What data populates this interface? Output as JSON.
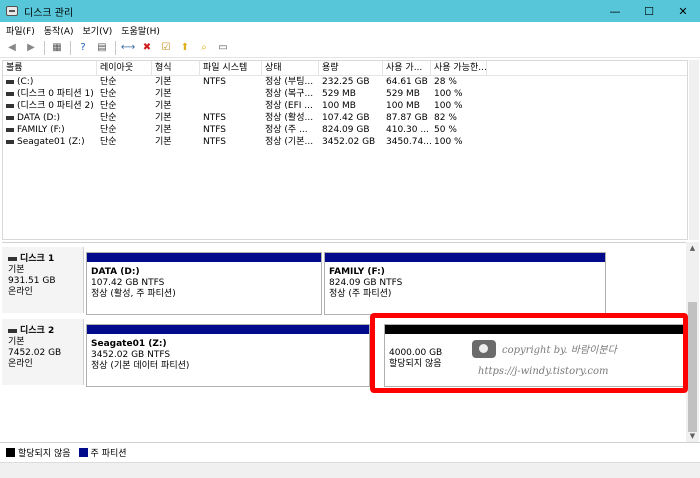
{
  "window": {
    "title": "디스크 관리",
    "controls": [
      "—",
      "☐",
      "✕"
    ]
  },
  "menu": [
    "파일(F)",
    "동작(A)",
    "보기(V)",
    "도움말(H)"
  ],
  "toolbar": [
    {
      "name": "back-icon",
      "glyph": "◀",
      "color": "#888888"
    },
    {
      "name": "forward-icon",
      "glyph": "▶",
      "color": "#888888"
    },
    {
      "name": "properties-icon",
      "glyph": "▦",
      "color": "#555555"
    },
    {
      "name": "help-icon",
      "glyph": "?",
      "color": "#1f5fbf"
    },
    {
      "name": "view-icon",
      "glyph": "▤",
      "color": "#555555"
    },
    {
      "name": "connect-icon",
      "glyph": "⟷",
      "color": "#3a6ea5"
    },
    {
      "name": "delete-icon",
      "glyph": "✖",
      "color": "#d11f1f"
    },
    {
      "name": "checklist-icon",
      "glyph": "☑",
      "color": "#c88a1a"
    },
    {
      "name": "folder-up-icon",
      "glyph": "⬆",
      "color": "#e0b020"
    },
    {
      "name": "folder-search-icon",
      "glyph": "⌕",
      "color": "#e0b020"
    },
    {
      "name": "console-icon",
      "glyph": "▭",
      "color": "#555555"
    }
  ],
  "volume_list": {
    "columns": [
      "볼륨",
      "레이아웃",
      "형식",
      "파일 시스템",
      "상태",
      "용량",
      "사용 가...",
      "사용 가능한..."
    ],
    "rows": [
      [
        "(C:)",
        "단순",
        "기본",
        "NTFS",
        "정상 (부팅...",
        "232.25 GB",
        "64.61 GB",
        "28 %"
      ],
      [
        "(디스크 0 파티션 1)",
        "단순",
        "기본",
        "",
        "정상 (복구...",
        "529 MB",
        "529 MB",
        "100 %"
      ],
      [
        "(디스크 0 파티션 2)",
        "단순",
        "기본",
        "",
        "정상 (EFI ...",
        "100 MB",
        "100 MB",
        "100 %"
      ],
      [
        "DATA (D:)",
        "단순",
        "기본",
        "NTFS",
        "정상 (활성...",
        "107.42 GB",
        "87.87 GB",
        "82 %"
      ],
      [
        "FAMILY (F:)",
        "단순",
        "기본",
        "NTFS",
        "정상 (주 ...",
        "824.09 GB",
        "410.30 ...",
        "50 %"
      ],
      [
        "Seagate01 (Z:)",
        "단순",
        "기본",
        "NTFS",
        "정상 (기본...",
        "3452.02 GB",
        "3450.74...",
        "100 %"
      ]
    ]
  },
  "disks": [
    {
      "name": "디스크 1",
      "type": "기본",
      "size": "931.51 GB",
      "status": "온라인",
      "partitions": [
        {
          "name": "DATA  (D:)",
          "size": "107.42 GB NTFS",
          "status": "정상 (활성, 주 파티션)",
          "kind": "primary"
        },
        {
          "name": "FAMILY  (F:)",
          "size": "824.09 GB NTFS",
          "status": "정상 (주 파티션)",
          "kind": "primary"
        }
      ]
    },
    {
      "name": "디스크 2",
      "type": "기본",
      "size": "7452.02 GB",
      "status": "온라인",
      "partitions": [
        {
          "name": "Seagate01  (Z:)",
          "size": "3452.02 GB NTFS",
          "status": "정상 (기본 데이터 파티션)",
          "kind": "primary"
        },
        {
          "name": "",
          "size": "4000.00 GB",
          "status": "할당되지 않음",
          "kind": "unallocated"
        }
      ]
    }
  ],
  "watermark": {
    "line1": "copyright by. 바람이분다",
    "line2": "https://j-windy.tistory.com"
  },
  "legend": [
    {
      "label": "할당되지 않음",
      "color": "#000000"
    },
    {
      "label": "주 파티션",
      "color": "#000a8a"
    }
  ]
}
